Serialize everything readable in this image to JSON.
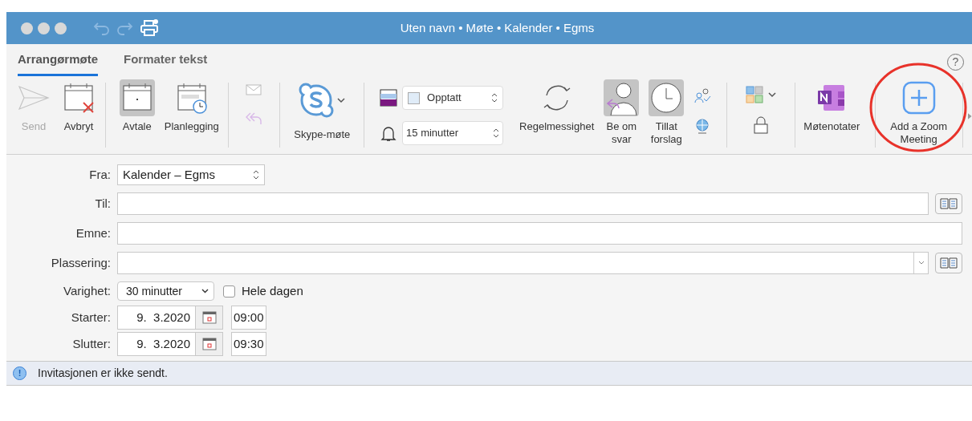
{
  "window": {
    "title": "Uten navn • Møte • Kalender • Egms"
  },
  "tabs": [
    {
      "label": "Arrangørmøte",
      "selected": true
    },
    {
      "label": "Formater tekst",
      "selected": false
    }
  ],
  "help": {
    "label": "?"
  },
  "ribbon": {
    "send": {
      "label": "Send",
      "disabled": true
    },
    "cancel": {
      "label": "Avbryt",
      "disabled": false
    },
    "appointment": {
      "label": "Avtale",
      "selected": true
    },
    "scheduling": {
      "label": "Planlegging",
      "selected": false
    },
    "skype": {
      "label": "Skype-møte"
    },
    "show_as": {
      "value": "Opptatt"
    },
    "reminder": {
      "value": "15 minutter"
    },
    "recurrence": {
      "label": "Regelmessighet"
    },
    "request_responses": {
      "label": "Be om svar",
      "selected": true
    },
    "allow_proposals": {
      "label": "Tillat forslag",
      "selected": true
    },
    "meeting_notes": {
      "label": "Møtenotater"
    },
    "zoom": {
      "label": "Add a Zoom Meeting",
      "highlighted": true
    }
  },
  "form": {
    "from": {
      "label": "Fra:",
      "value": "Kalender – Egms"
    },
    "to": {
      "label": "Til:"
    },
    "subject": {
      "label": "Emne:"
    },
    "location": {
      "label": "Plassering:"
    },
    "duration": {
      "label": "Varighet:",
      "value": "30 minutter"
    },
    "all_day": {
      "label": "Hele dagen",
      "checked": false
    },
    "start": {
      "label": "Starter:",
      "date": "9.  3.2020",
      "time": "09:00"
    },
    "end": {
      "label": "Slutter:",
      "date": "9.  3.2020",
      "time": "09:30"
    }
  },
  "info_bar": {
    "icon_text": "!",
    "text": "Invitasjonen er ikke sendt."
  }
}
